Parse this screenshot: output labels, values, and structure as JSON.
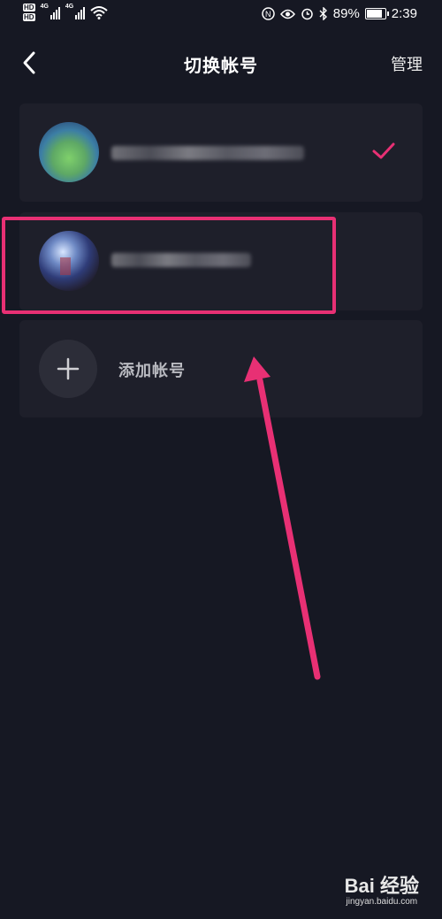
{
  "status_bar": {
    "hd_labels": [
      "HD",
      "HD"
    ],
    "network_labels": [
      "4G",
      "4G"
    ],
    "battery_percent": "89%",
    "time": "2:39",
    "icons": [
      "nfc-icon",
      "eye-icon",
      "alarm-icon",
      "bluetooth-icon",
      "battery-icon"
    ]
  },
  "header": {
    "title": "切换帐号",
    "manage_label": "管理",
    "back_icon": "chevron-left-icon"
  },
  "accounts": [
    {
      "name_blurred": true,
      "selected": true,
      "check_icon": "check-icon"
    },
    {
      "name_blurred": true,
      "selected": false
    }
  ],
  "add_account": {
    "label": "添加帐号",
    "icon": "plus-icon"
  },
  "annotations": {
    "highlight_color": "#e83074",
    "arrow_color": "#e83074"
  },
  "watermark": {
    "logo_text": "Bai 经验",
    "sub_text": "jingyan.baidu.com"
  },
  "colors": {
    "background": "#161823",
    "card": "#1e1f2a",
    "accent": "#e83074"
  }
}
